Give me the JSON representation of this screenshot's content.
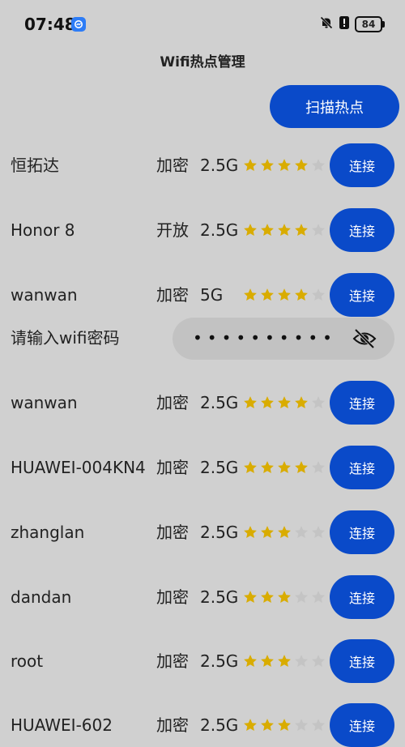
{
  "status_bar": {
    "time": "07:48",
    "battery": "84"
  },
  "header": {
    "title": "Wifi热点管理"
  },
  "scan_button_label": "扫描热点",
  "connect_label": "连接",
  "colors": {
    "accent": "#0a4ac9",
    "star_on": "#d9ac00",
    "star_off": "#c4c4c4",
    "background": "#d0d0d0"
  },
  "password_prompt": {
    "label": "请输入wifi密码",
    "masked_value": "••••••••••"
  },
  "networks": [
    {
      "ssid": "恒拓达",
      "security": "加密",
      "band": "2.5G",
      "signal": 4
    },
    {
      "ssid": "Honor 8",
      "security": "开放",
      "band": "2.5G",
      "signal": 4
    },
    {
      "ssid": "wanwan",
      "security": "加密",
      "band": "5G",
      "signal": 4
    },
    {
      "ssid": "wanwan",
      "security": "加密",
      "band": "2.5G",
      "signal": 4
    },
    {
      "ssid": "HUAWEI-004KN4",
      "security": "加密",
      "band": "2.5G",
      "signal": 4
    },
    {
      "ssid": "zhanglan",
      "security": "加密",
      "band": "2.5G",
      "signal": 3
    },
    {
      "ssid": "dandan",
      "security": "加密",
      "band": "2.5G",
      "signal": 3
    },
    {
      "ssid": "root",
      "security": "加密",
      "band": "2.5G",
      "signal": 3
    },
    {
      "ssid": "HUAWEI-602",
      "security": "加密",
      "band": "2.5G",
      "signal": 3
    }
  ],
  "signal_max": 5
}
